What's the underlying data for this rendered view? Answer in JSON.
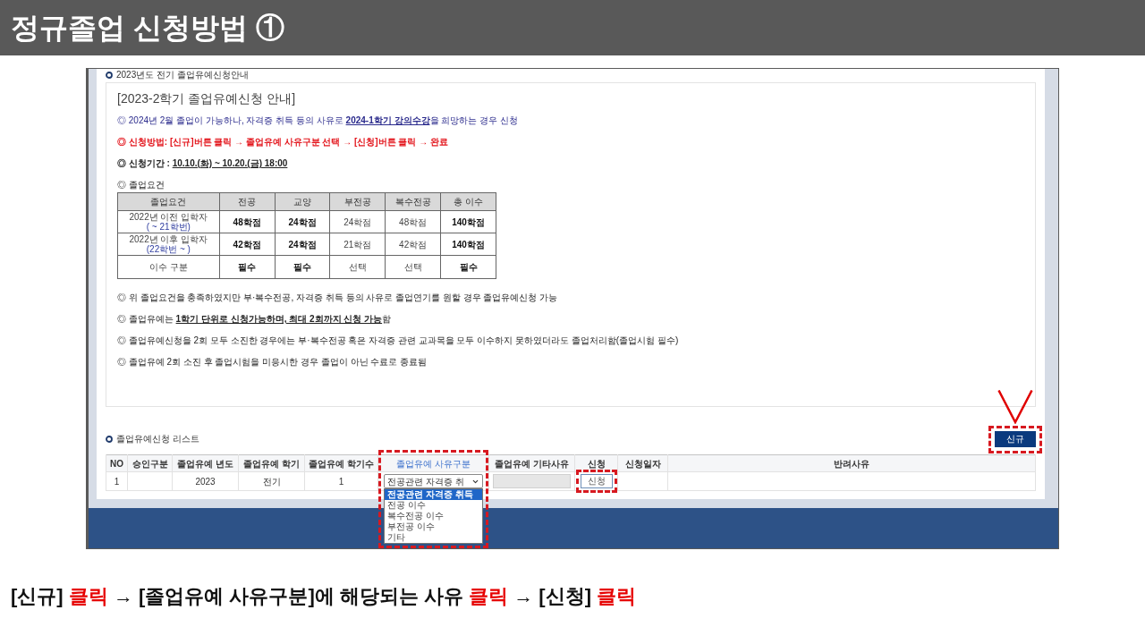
{
  "title": "정규졸업 신청방법 ①",
  "screen": {
    "section_title": "2023년도 전기 졸업유예신청안내",
    "notice": {
      "title": "[2023-2학기 졸업유예신청 안내]",
      "items": [
        {
          "kind": "text",
          "color": "#2a2a8c",
          "parts": [
            {
              "text": "◎ 2024년 2월 졸업이 가능하나, 자격증 취득 등의 사유로 ",
              "underline": false
            },
            {
              "text": "**2024-1학기 강의수강**",
              "underline": true
            },
            {
              "text": "을 희망하는 경우 신청",
              "underline": false
            }
          ]
        },
        {
          "kind": "text",
          "color": "#e3141b",
          "parts": [
            {
              "text": "**◎ 신청방법: [신규]버튼 클릭 → 졸업유예 사유구분 선택 → [신청]버튼 클릭 → 완료**",
              "underline": false
            }
          ]
        },
        {
          "kind": "text",
          "parts": [
            {
              "text": "**◎ 신청기간 :** ",
              "underline": false
            },
            {
              "text": "**10.10.(화) ~ 10.20.(금) 18:00**",
              "underline": true
            }
          ]
        },
        {
          "kind": "text",
          "parts": [
            {
              "text": "◎ 졸업요건",
              "underline": false
            }
          ]
        },
        {
          "kind": "table",
          "columns": [
            "졸업요건",
            "전공",
            "교양",
            "부전공",
            "복수전공",
            "총 이수"
          ],
          "rows": [
            {
              "cells": [
                {
                  "text": "2022년 이전 입학자",
                  "note": "( ~ 21학번)",
                  "bold": false
                },
                {
                  "text": "48학점",
                  "bold": true
                },
                {
                  "text": "24학점",
                  "bold": true
                },
                {
                  "text": "24학점",
                  "bold": false
                },
                {
                  "text": "48학점",
                  "bold": false
                },
                {
                  "text": "140학점",
                  "bold": true
                }
              ]
            },
            {
              "cells": [
                {
                  "text": "2022년 이후 입학자",
                  "note": "(22학번 ~ )",
                  "bold": false
                },
                {
                  "text": "42학점",
                  "bold": true
                },
                {
                  "text": "24학점",
                  "bold": true
                },
                {
                  "text": "21학점",
                  "bold": false
                },
                {
                  "text": "42학점",
                  "bold": false
                },
                {
                  "text": "140학점",
                  "bold": true
                }
              ]
            },
            {
              "cells": [
                {
                  "text": "이수 구분",
                  "bold": false
                },
                {
                  "text": "필수",
                  "bold": true
                },
                {
                  "text": "필수",
                  "bold": true
                },
                {
                  "text": "선택",
                  "bold": false
                },
                {
                  "text": "선택",
                  "bold": false
                },
                {
                  "text": "필수",
                  "bold": true
                }
              ]
            }
          ]
        },
        {
          "kind": "text",
          "parts": [
            {
              "text": "◎ 위 졸업요건을 충족하였지만 부·복수전공, 자격증 취득 등의 사유로 졸업연기를 원할 경우 졸업유예신청 가능",
              "underline": false
            }
          ]
        },
        {
          "kind": "text",
          "parts": [
            {
              "text": "◎ 졸업유예는 ",
              "underline": false
            },
            {
              "text": "**1학기 단위로 신청가능하며, 최대 2회까지 신청 가능**",
              "underline": true
            },
            {
              "text": "함",
              "underline": false
            }
          ]
        },
        {
          "kind": "text",
          "parts": [
            {
              "text": "◎ 졸업유예신청을 2회 모두 소진한 경우에는 부·복수전공 혹은 자격증 관련 교과목을 모두 이수하지 못하였더라도 졸업처리함(졸업시험 필수)",
              "underline": false
            }
          ]
        },
        {
          "kind": "text",
          "parts": [
            {
              "text": "◎ 졸업유예 2회 소진 후 졸업시험을 미응시한 경우 졸업이 아닌 수료로 종료됨",
              "underline": false
            }
          ]
        }
      ]
    },
    "list_title": "졸업유예신청 리스트",
    "new_button": {
      "label": "신규",
      "highlighted": true,
      "pointer_mark": true
    },
    "table": {
      "columns": [
        {
          "label": "NO",
          "accent": false,
          "highlighted": false
        },
        {
          "label": "승인구분",
          "accent": false,
          "highlighted": false
        },
        {
          "label": "졸업유예 년도",
          "accent": false,
          "highlighted": false
        },
        {
          "label": "졸업유예 학기",
          "accent": false,
          "highlighted": false
        },
        {
          "label": "졸업유예 학기수",
          "accent": false,
          "highlighted": false
        },
        {
          "label": "졸업유예 사유구분",
          "accent": true,
          "highlighted": true
        },
        {
          "label": "졸업유예 기타사유",
          "accent": false,
          "highlighted": false
        },
        {
          "label": "신청",
          "accent": false,
          "highlighted": false
        },
        {
          "label": "신청일자",
          "accent": false,
          "highlighted": false
        },
        {
          "label": "반려사유",
          "accent": false,
          "highlighted": false
        }
      ],
      "rows": [
        {
          "cells": [
            {
              "kind": "text",
              "text": "1"
            },
            {
              "kind": "empty"
            },
            {
              "kind": "text",
              "text": "2023"
            },
            {
              "kind": "text",
              "text": "전기"
            },
            {
              "kind": "text",
              "text": "1"
            },
            {
              "kind": "select",
              "value": "전공관련 자격증 취",
              "expanded": true,
              "options": [
                {
                  "label": "전공관련 자격증 취득",
                  "selected": true
                },
                {
                  "label": "전공 이수",
                  "selected": false
                },
                {
                  "label": "복수전공 이수",
                  "selected": false
                },
                {
                  "label": "부전공 이수",
                  "selected": false
                },
                {
                  "label": "기타",
                  "selected": false
                }
              ]
            },
            {
              "kind": "input",
              "disabled": true
            },
            {
              "kind": "button",
              "label": "신청",
              "highlighted": true
            },
            {
              "kind": "empty"
            },
            {
              "kind": "empty"
            }
          ]
        }
      ]
    }
  },
  "caption": [
    {
      "text": "[신규] ",
      "accent": false
    },
    {
      "text": "클릭",
      "accent": true
    },
    {
      "text": " → [졸업유예 사유구분]에 해당되는 사유 ",
      "accent": false
    },
    {
      "text": "클릭",
      "accent": true
    },
    {
      "text": " → [신청] ",
      "accent": false
    },
    {
      "text": "클릭",
      "accent": true
    }
  ]
}
